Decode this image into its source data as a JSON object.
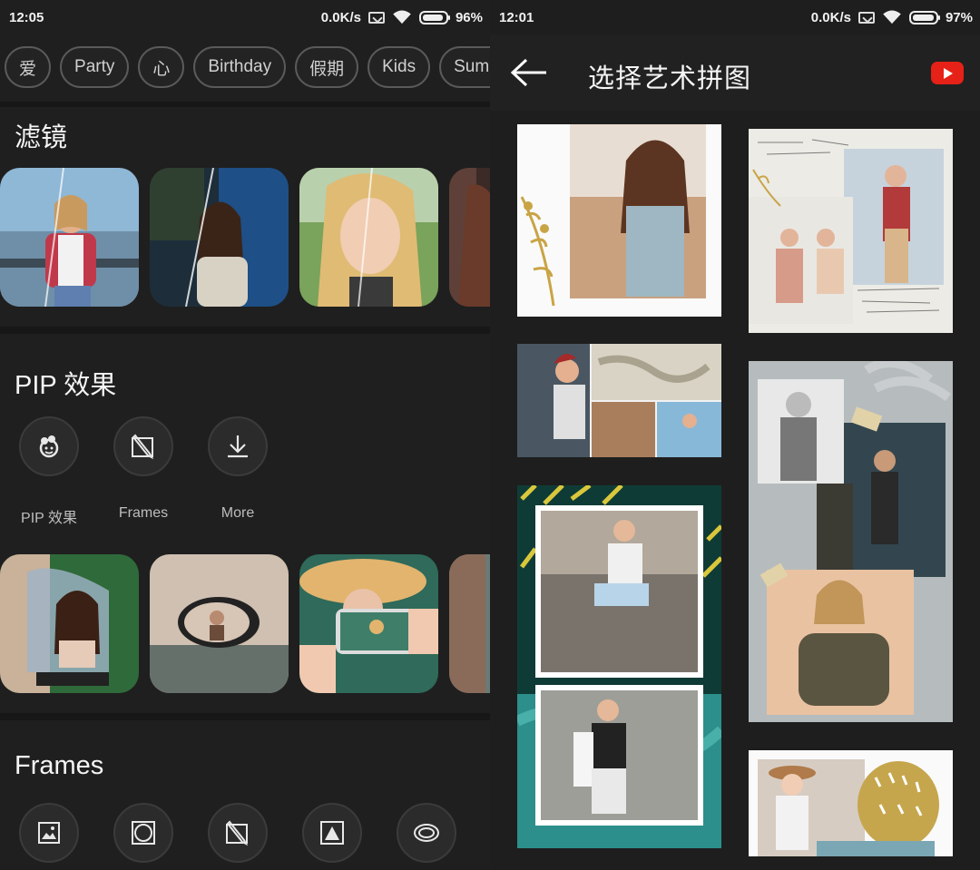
{
  "left": {
    "status": {
      "time": "12:05",
      "speed": "0.0K/s",
      "battery": "96%",
      "battery_level": 0.96
    },
    "chips": [
      "爱",
      "Party",
      "心",
      "Birthday",
      "假期",
      "Kids",
      "Summ"
    ],
    "filters_section": {
      "title": "滤镜"
    },
    "pip_section": {
      "title": "PIP 效果",
      "tools": [
        {
          "icon": "pip-flower-icon",
          "label": "PIP 效果"
        },
        {
          "icon": "frame-pencil-icon",
          "label": "Frames"
        },
        {
          "icon": "download-icon",
          "label": "More"
        }
      ]
    },
    "frames_section": {
      "title": "Frames",
      "tools": [
        {
          "icon": "frame-image-icon"
        },
        {
          "icon": "frame-circle-icon"
        },
        {
          "icon": "frame-pencil-icon"
        },
        {
          "icon": "frame-triangle-icon"
        },
        {
          "icon": "frame-oval-icon"
        }
      ]
    }
  },
  "right": {
    "status": {
      "time": "12:01",
      "speed": "0.0K/s",
      "battery": "97%",
      "battery_level": 0.97
    },
    "title": "选择艺术拼图",
    "icons": {
      "back": "back-arrow-icon",
      "youtube": "youtube-icon"
    }
  },
  "colors": {
    "bg": "#1f1f1f",
    "youtube_red": "#e62117",
    "chip_border": "#5a5a5a"
  }
}
